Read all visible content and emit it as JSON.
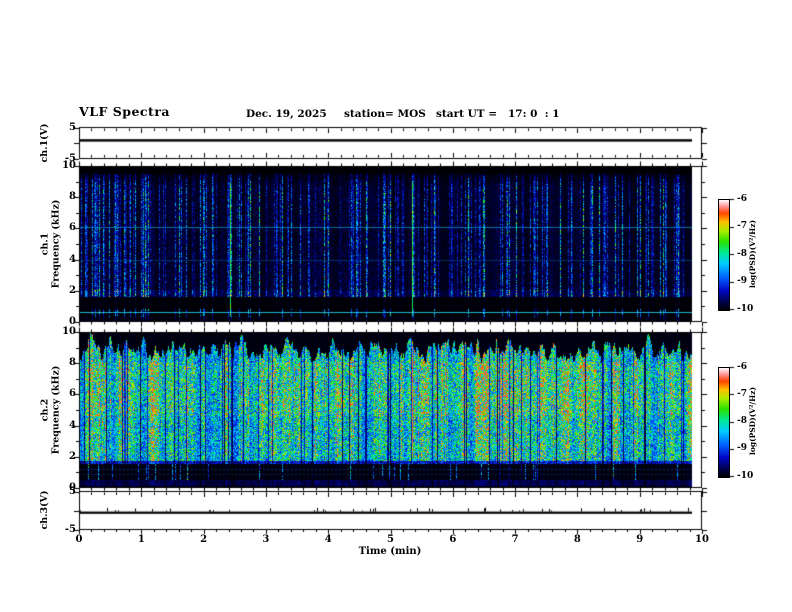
{
  "chart_data": {
    "type": "heatmap",
    "title": "VLF Spectra",
    "header": {
      "date": "Dec. 19, 2025",
      "station": "station= MOS",
      "start_ut": "start UT =   17: 0  : 1"
    },
    "time_axis": {
      "label": "Time (min)",
      "min": 0,
      "max": 10,
      "major_step_min": 1,
      "minor_step_min": 0.2,
      "tick_labels": [
        "0",
        "1",
        "2",
        "3",
        "4",
        "5",
        "6",
        "7",
        "8",
        "9",
        "10"
      ],
      "tick_values": [
        0,
        1,
        2,
        3,
        4,
        5,
        6,
        7,
        8,
        9,
        10
      ],
      "data_end_min": 9.84
    },
    "panels": [
      {
        "id": "ch1-voltage",
        "kind": "trace",
        "ylabel": "ch.1(V)",
        "ymin": -5,
        "ymax": 5,
        "ytick_labels": [
          "5",
          "-5"
        ],
        "ytick_values": [
          5,
          -5
        ],
        "trace_level_v": 0
      },
      {
        "id": "ch1-spectrogram",
        "kind": "spectrogram",
        "ylabel_lines": [
          "ch.1",
          "Frequency (kHz)"
        ],
        "ymin": 0,
        "ymax": 10,
        "ytick_labels": [
          "10",
          "8",
          "6",
          "4",
          "2",
          "0"
        ],
        "ytick_values": [
          10,
          8,
          6,
          4,
          2,
          0
        ],
        "features": {
          "style": "sparse vertical streaks on black",
          "horizontal_lines_khz": [
            6.1,
            4.0,
            0.65
          ],
          "activity_band_khz": [
            1.6,
            2.05
          ],
          "quiet_band_khz": [
            0.85,
            1.6
          ],
          "strong_streaks_min": [
            2.42,
            5.35
          ],
          "seed": 1234
        }
      },
      {
        "id": "ch2-spectrogram",
        "kind": "spectrogram",
        "ylabel_lines": [
          "ch.2",
          "Frequency (kHz)"
        ],
        "ymin": 0,
        "ymax": 10,
        "ytick_labels": [
          "10",
          "8",
          "6",
          "4",
          "2",
          "0"
        ],
        "ytick_values": [
          10,
          8,
          6,
          4,
          2,
          0
        ],
        "features": {
          "style": "dense vertical streaks, green-cyan with red hot spots",
          "dense_band_khz": [
            1.75,
            9.7
          ],
          "quiet_band_khz": [
            0.5,
            1.55
          ],
          "noise_floor_khz": [
            0.1,
            0.5
          ],
          "dotted_lines_khz": [
            1.25,
            0.9
          ],
          "hot_streaks_min": [
            5.35
          ],
          "seed": 777
        }
      },
      {
        "id": "ch3-voltage",
        "kind": "trace",
        "ylabel": "ch.3(V)",
        "ymin": -5,
        "ymax": 5,
        "ytick_labels": [
          "5",
          "-5"
        ],
        "ytick_values": [
          5,
          -5
        ],
        "trace_level_v": 0
      }
    ],
    "colorbars": [
      {
        "label": "log(PSD)(V²/Hz)",
        "tick_labels": [
          "-6",
          "-7",
          "-8",
          "-9",
          "-10"
        ],
        "tick_values": [
          -6,
          -7,
          -8,
          -9,
          -10
        ],
        "top_value": -6,
        "bottom_value": -10
      },
      {
        "label": "log(PSD)(V²/Hz)",
        "tick_labels": [
          "-6",
          "-7",
          "-8",
          "-9",
          "-10"
        ],
        "tick_values": [
          -6,
          -7,
          -8,
          -9,
          -10
        ],
        "top_value": -6,
        "bottom_value": -10
      }
    ],
    "colormap_stops": [
      {
        "t": 0.0,
        "c": "#000004"
      },
      {
        "t": 0.07,
        "c": "#000048"
      },
      {
        "t": 0.18,
        "c": "#0008c8"
      },
      {
        "t": 0.3,
        "c": "#0064ff"
      },
      {
        "t": 0.42,
        "c": "#00ccff"
      },
      {
        "t": 0.52,
        "c": "#00e896"
      },
      {
        "t": 0.62,
        "c": "#28e000"
      },
      {
        "t": 0.72,
        "c": "#aaee00"
      },
      {
        "t": 0.8,
        "c": "#ffc000"
      },
      {
        "t": 0.88,
        "c": "#ff4400"
      },
      {
        "t": 0.94,
        "c": "#ff9090"
      },
      {
        "t": 1.0,
        "c": "#ffffff"
      }
    ]
  }
}
